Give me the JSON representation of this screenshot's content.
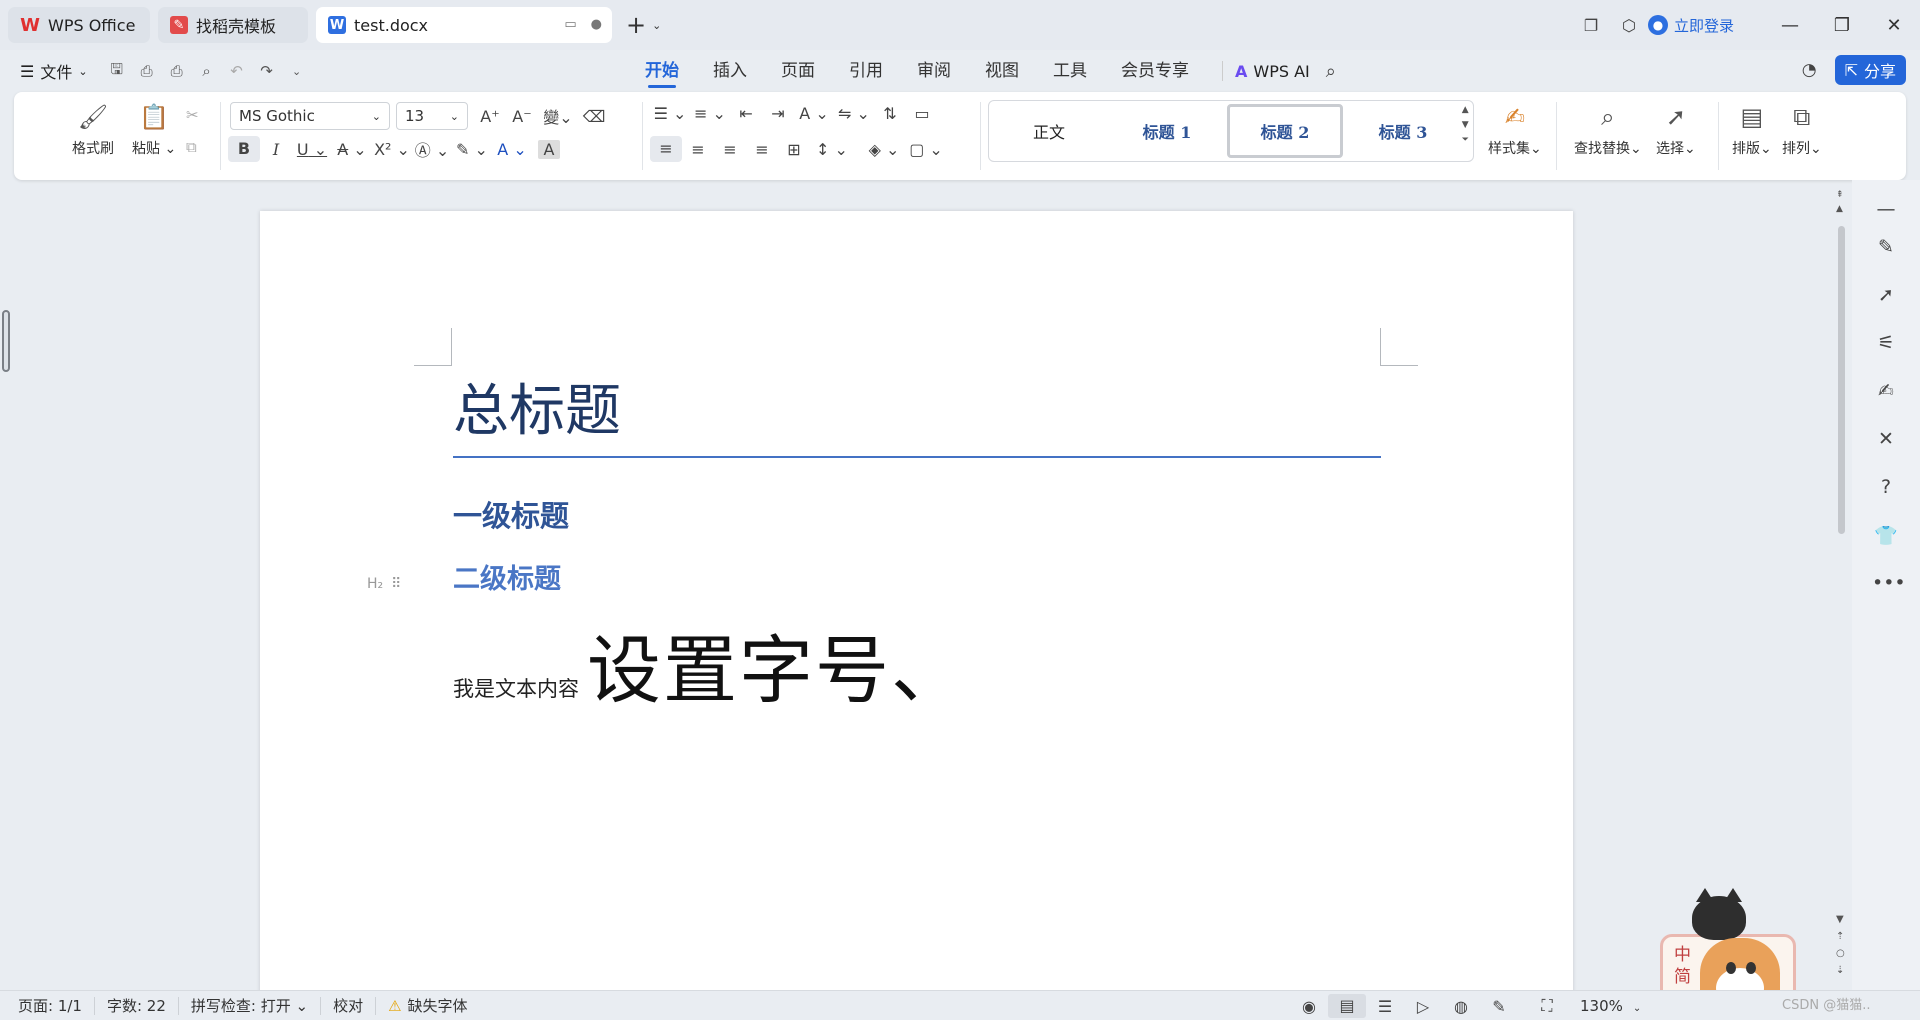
{
  "tabs": {
    "home": "WPS Office",
    "template": "找稻壳模板",
    "document": "test.docx",
    "new_tab": "+"
  },
  "titlebar": {
    "login": "立即登录"
  },
  "menubar": {
    "file": "文件",
    "menus": [
      "开始",
      "插入",
      "页面",
      "引用",
      "审阅",
      "视图",
      "工具",
      "会员专享"
    ],
    "active_menu": "开始",
    "wps_ai": "WPS AI",
    "share": "分享"
  },
  "ribbon": {
    "format_painter": "格式刷",
    "paste": "粘贴",
    "font_name": "MS Gothic",
    "font_size": "13",
    "bold": "B",
    "italic": "I",
    "underline": "U",
    "styles": [
      "正文",
      "标题 1",
      "标题 2",
      "标题 3"
    ],
    "selected_style": "标题 2",
    "style_set": "样式集",
    "find_replace": "查找替换",
    "select": "选择",
    "layout": "排版",
    "arrange": "排列"
  },
  "document": {
    "title": "总标题",
    "heading1": "一级标题",
    "heading2": "二级标题",
    "heading2_marker": "H₂",
    "body_small": "我是文本内容",
    "body_large": "设置字号、"
  },
  "statusbar": {
    "page": "页面: 1/1",
    "word_count": "字数: 22",
    "spell_check": "拼写检查: 打开",
    "proofread": "校对",
    "missing_font": "缺失字体",
    "zoom": "130%"
  },
  "mascot": {
    "text": "中简"
  },
  "watermark": "CSDN @猫猫.."
}
